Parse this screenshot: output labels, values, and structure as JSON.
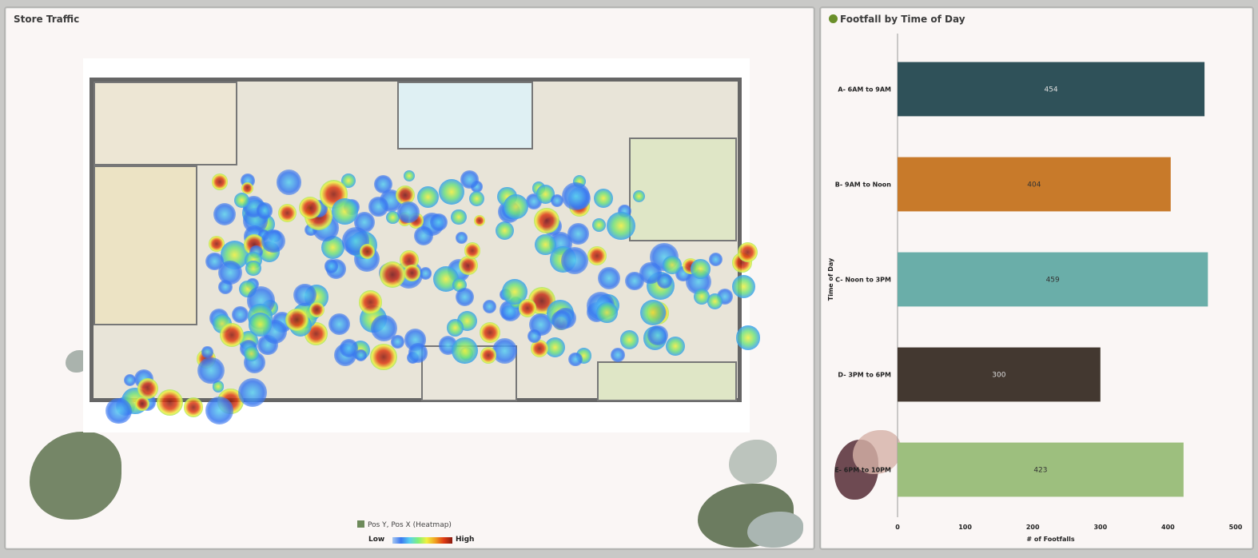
{
  "left_panel": {
    "title": "Store Traffic",
    "legend_title": "Pos Y, Pos X (Heatmap)",
    "legend_low": "Low",
    "legend_high": "High",
    "icon": "heatmap-icon"
  },
  "right_panel": {
    "title": "Footfall by Time of Day",
    "icon": "filter-icon"
  },
  "chart_data": {
    "type": "bar",
    "orientation": "horizontal",
    "title": "Footfall by Time of Day",
    "categories": [
      "A- 6AM to 9AM",
      "B- 9AM to Noon",
      "C- Noon to 3PM",
      "D- 3PM to 6PM",
      "E- 6PM to 10PM"
    ],
    "values": [
      454,
      404,
      459,
      300,
      423
    ],
    "colors": [
      "#2f5159",
      "#c87a2a",
      "#6aaea9",
      "#433830",
      "#9dbf7e"
    ],
    "xlabel": "# of Footfalls",
    "ylabel": "Time of Day",
    "xlim": [
      0,
      500
    ],
    "xticks": [
      "0",
      "100",
      "200",
      "300",
      "400",
      "500"
    ],
    "grid": false
  }
}
